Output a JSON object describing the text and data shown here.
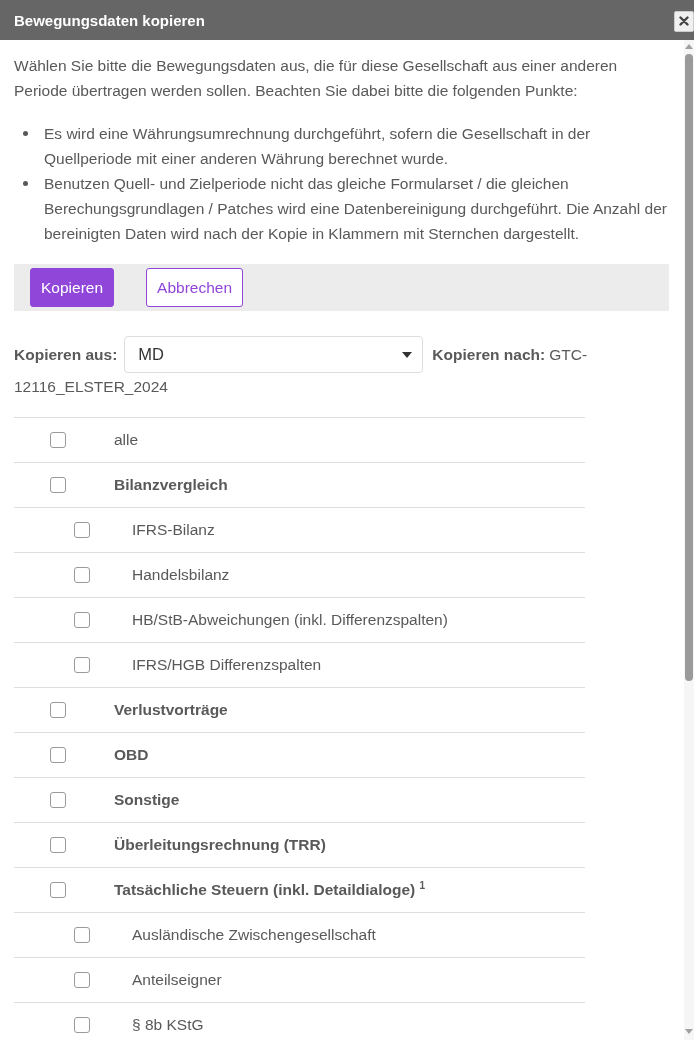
{
  "dialog": {
    "title": "Bewegungsdaten kopieren"
  },
  "intro": "Wählen Sie bitte die Bewegungsdaten aus, die für diese Gesellschaft aus einer anderen Periode übertragen werden sollen. Beachten Sie dabei bitte die folgenden Punkte:",
  "notes": [
    "Es wird eine Währungsumrechnung durchgeführt, sofern die Gesellschaft in der Quellperiode mit einer anderen Währung berechnet wurde.",
    "Benutzen Quell- und Zielperiode nicht das gleiche Formularset / die gleichen Berechungsgrundlagen / Patches wird eine Datenbereinigung durchgeführt. Die Anzahl der bereinigten Daten wird nach der Kopie in Klammern mit Sternchen dargestellt."
  ],
  "actions": [
    {
      "label": "Kopieren",
      "kind": "primary"
    },
    {
      "label": "Abbrechen",
      "kind": "secondary"
    }
  ],
  "source": {
    "label": "Kopieren aus:",
    "value": "MD"
  },
  "target": {
    "label": "Kopieren nach:",
    "value": "GTC-12116_ELSTER_2024"
  },
  "items": [
    {
      "label": "alle",
      "kind": "all",
      "checked": false
    },
    {
      "label": "Bilanzvergleich",
      "kind": "group",
      "checked": false,
      "children": [
        {
          "label": "IFRS-Bilanz",
          "kind": "item",
          "checked": false
        },
        {
          "label": "Handelsbilanz",
          "kind": "item",
          "checked": false
        },
        {
          "label": "HB/StB-Abweichungen (inkl. Differenzspalten)",
          "kind": "item",
          "checked": false
        },
        {
          "label": "IFRS/HGB Differenzspalten",
          "kind": "item",
          "checked": false
        }
      ]
    },
    {
      "label": "Verlustvorträge",
      "kind": "group",
      "checked": false
    },
    {
      "label": "OBD",
      "kind": "group",
      "checked": false
    },
    {
      "label": "Sonstige",
      "kind": "group",
      "checked": false
    },
    {
      "label": "Überleitungsrechnung (TRR)",
      "kind": "group",
      "checked": false
    },
    {
      "label": "Tatsächliche Steuern (inkl. Detaildialoge) $^{1}$",
      "kind": "group",
      "checked": false,
      "children": [
        {
          "label": "Ausländische Zwischengesellschaft",
          "kind": "item",
          "checked": false
        },
        {
          "label": "Anteilseigner",
          "kind": "item",
          "checked": false
        },
        {
          "label": "§ 8b KStG",
          "kind": "item",
          "checked": false
        }
      ]
    }
  ]
}
